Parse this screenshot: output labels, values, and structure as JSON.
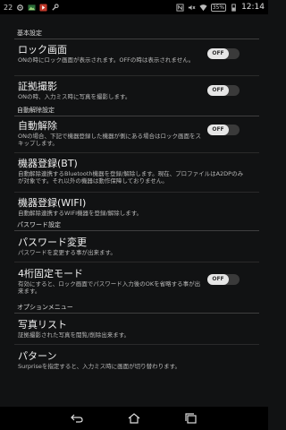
{
  "status_bar": {
    "left_number": "22",
    "time": "12:14",
    "battery_percent": "35%",
    "icons": [
      "gear-icon",
      "image-icon",
      "video-icon",
      "wrench-icon",
      "nfc-icon",
      "mute-icon",
      "wifi-icon",
      "battery-icon"
    ]
  },
  "sections": {
    "basic": "基本設定",
    "auto_unlock": "自動解除設定",
    "password": "パスワード設定",
    "options": "オプションメニュー"
  },
  "settings": {
    "lock_screen": {
      "title": "ロック画面",
      "description": "ONの時にロック画面が表示されます。OFFの時は表示されません。",
      "toggle": "OFF"
    },
    "evidence_photo": {
      "title": "証拠撮影",
      "description": "ONの時、入力ミス時に写真を撮影します。",
      "toggle": "OFF"
    },
    "auto_unlock": {
      "title": "自動解除",
      "description": "ONの場合、下記で機器登録した機器が側にある場合はロック画面をスキップします。",
      "toggle": "OFF"
    },
    "device_bt": {
      "title": "機器登録(BT)",
      "description": "自動解除連携するBluetooth機器を登録/解除します。現在、プロファイルはA2DPのみが対象です。それ以外の機器は動作保障しておりません。"
    },
    "device_wifi": {
      "title": "機器登録(WIFI)",
      "description": "自動解除連携するWIFI機器を登録/解除します。"
    },
    "password_change": {
      "title": "パスワード変更",
      "description": "パスワードを変更する事が出来ます。"
    },
    "fixed4": {
      "title": "4桁固定モード",
      "description": "有効にすると、ロック画面でパスワード入力後のOKを省略する事が出来ます。",
      "toggle": "OFF"
    },
    "photo_list": {
      "title": "写真リスト",
      "description": "証拠撮影された写真を閲覧/削除出来ます。"
    },
    "pattern": {
      "title": "パターン",
      "description": "Surpriseを指定すると、入力ミス時に画面が切り替わります。"
    }
  },
  "navigation": {
    "icons": [
      "back-icon",
      "home-icon",
      "recent-apps-icon"
    ]
  },
  "colors": {
    "background": "#111213",
    "toggle_off_track": "#3a3a3a",
    "toggle_knob": "#e6e6e6"
  }
}
